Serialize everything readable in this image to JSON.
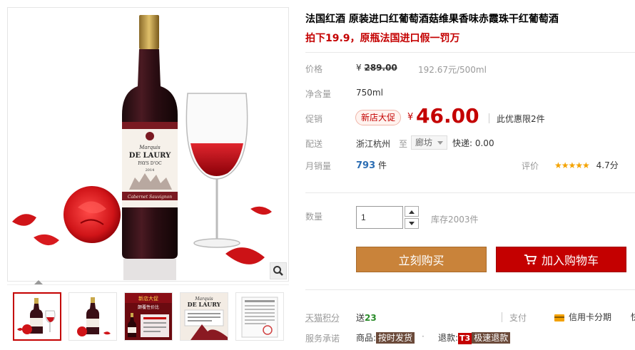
{
  "product": {
    "title": "法国红酒 原装进口红葡萄酒菇维果香味赤霞珠干红葡萄酒",
    "subtitle": "拍下19.9，原瓶法国进口假一罚万",
    "bottle_label": {
      "line1": "Marquis",
      "brand": "DE LAURY",
      "line3": "PAYS D'OC",
      "year": "2014",
      "varietal": "Cabernet Sauvignon"
    }
  },
  "price": {
    "label": "价格",
    "currency": "¥",
    "original": "289.00",
    "unit_price": "192.67元/500ml"
  },
  "net_content": {
    "label": "净含量",
    "value": "750ml"
  },
  "promo": {
    "label": "促销",
    "badge": "新店大促",
    "currency": "¥",
    "price": "46.00",
    "limit": "此优惠限2件"
  },
  "shipping": {
    "label": "配送",
    "from": "浙江杭州",
    "to_word": "至",
    "destination": "廊坊",
    "express": "快递: 0.00"
  },
  "sales": {
    "label": "月销量",
    "count": "793",
    "unit": "件",
    "rating_label": "评价",
    "stars": "★★★★★",
    "rating": "4.7分"
  },
  "quantity": {
    "label": "数量",
    "value": "1",
    "stock": "库存2003件"
  },
  "buttons": {
    "buy_now": "立刻购买",
    "add_to_cart": "加入购物车"
  },
  "points": {
    "label": "天猫积分",
    "prefix": "送",
    "value": "23",
    "pay_label": "支付",
    "credit": "信用卡分期",
    "cut": "快"
  },
  "service": {
    "label": "服务承诺",
    "goods_label": "商品:",
    "goods_tag": "按时发货",
    "dot": "·",
    "refund_label": "退款:",
    "refund_badge": "T3",
    "refund_tag": "极速退款"
  },
  "thumb_labels": {
    "t3_top": "新店大促",
    "t3_sub": "颠覆性价比",
    "t4_line1": "Marquis",
    "t4_brand": "DE LAURY"
  },
  "colors": {
    "accent_red": "#c40000",
    "buy_orange": "#c9833a",
    "sales_blue": "#2b6db3",
    "star_gold": "#f4a300"
  }
}
